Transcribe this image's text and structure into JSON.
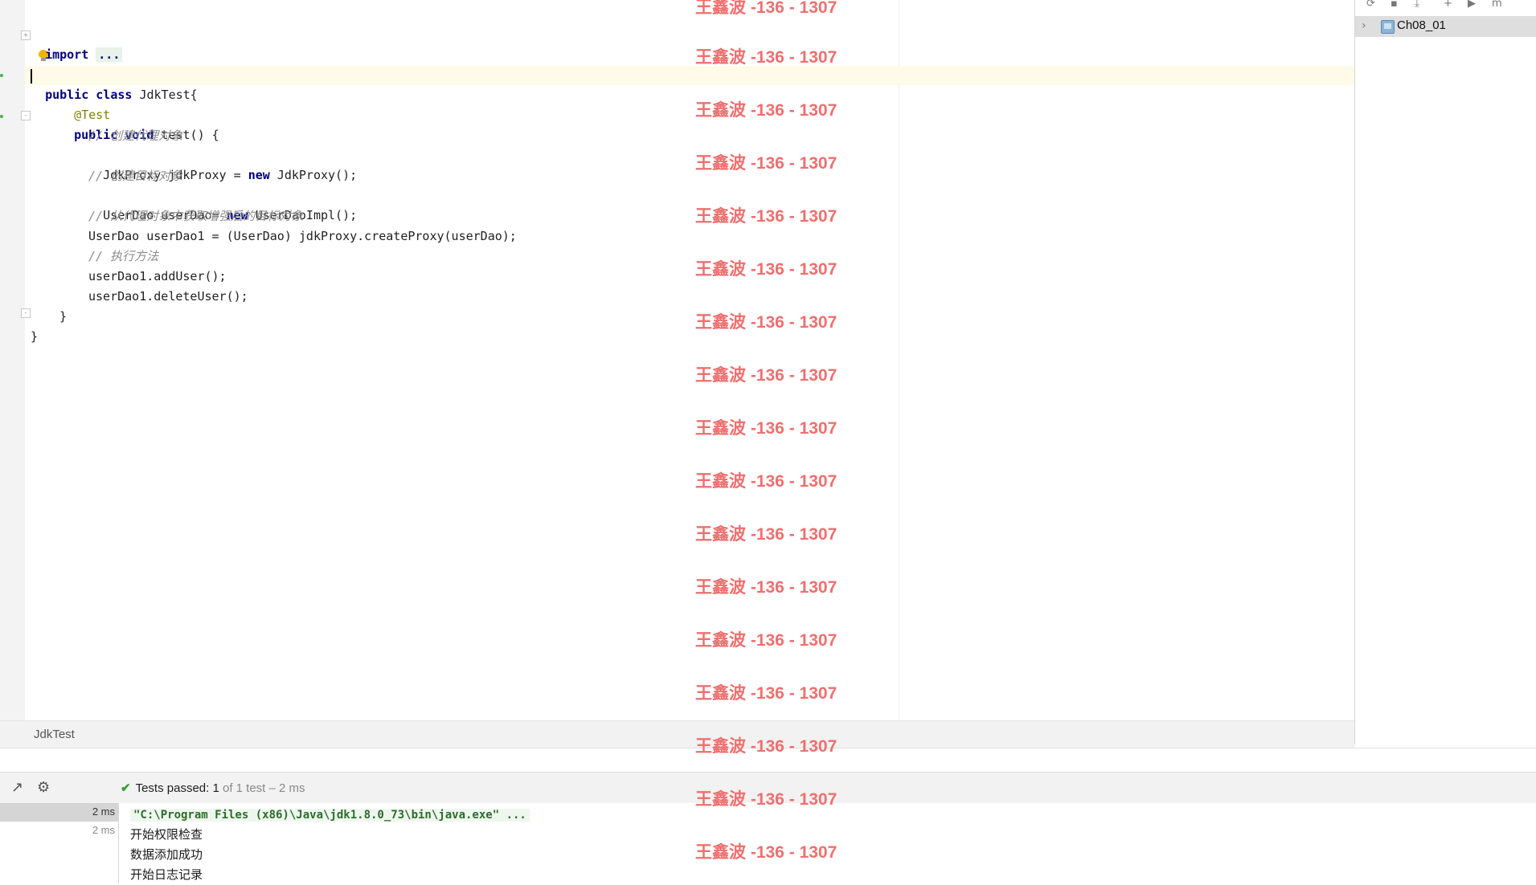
{
  "editor": {
    "lines": [
      {
        "kind": "import",
        "keyword": "import",
        "folded": "..."
      },
      {
        "kind": "class",
        "keywords": "public class",
        "rest": " JdkTest{"
      },
      {
        "kind": "annotation",
        "text": "@Test"
      },
      {
        "kind": "method",
        "keywords": "public void",
        "rest": " test() {"
      },
      {
        "kind": "comment",
        "text": "// 创建代理对象"
      },
      {
        "kind": "code",
        "before": "JdkProxy jdkProxy = ",
        "kw": "new",
        "after": " JdkProxy();"
      },
      {
        "kind": "comment",
        "text": "// 创建目标对象"
      },
      {
        "kind": "code",
        "before": "UserDao userDao= ",
        "kw": "new",
        "after": " UserDaoImpl();"
      },
      {
        "kind": "comment",
        "text": "// 从代理对象中获取增强后的目标对象"
      },
      {
        "kind": "plain",
        "text": "UserDao userDao1 = (UserDao) jdkProxy.createProxy(userDao);"
      },
      {
        "kind": "comment",
        "text": "// 执行方法"
      },
      {
        "kind": "plain",
        "text": "userDao1.addUser();"
      },
      {
        "kind": "plain",
        "text": "userDao1.deleteUser();"
      },
      {
        "kind": "plain",
        "text": "}"
      },
      {
        "kind": "plain",
        "text": "}"
      }
    ]
  },
  "breadcrumb": {
    "label": "JdkTest"
  },
  "project_tree": {
    "item": "Ch08_01"
  },
  "run": {
    "status_label": "Tests passed:",
    "passed_count": "1",
    "status_detail": "of 1 test – 2 ms",
    "tree_times": [
      "2 ms",
      "2 ms"
    ],
    "console": [
      "\"C:\\Program Files (x86)\\Java\\jdk1.8.0_73\\bin\\java.exe\" ...",
      "开始权限检查",
      "数据添加成功",
      "开始日志记录"
    ]
  },
  "watermark": "王鑫波 -136 - 1307",
  "colors": {
    "keyword": "#000080",
    "annotation": "#808000",
    "comment": "#8c8c8c",
    "watermark": "#ef6f6f",
    "pass": "#3a9a3a"
  }
}
